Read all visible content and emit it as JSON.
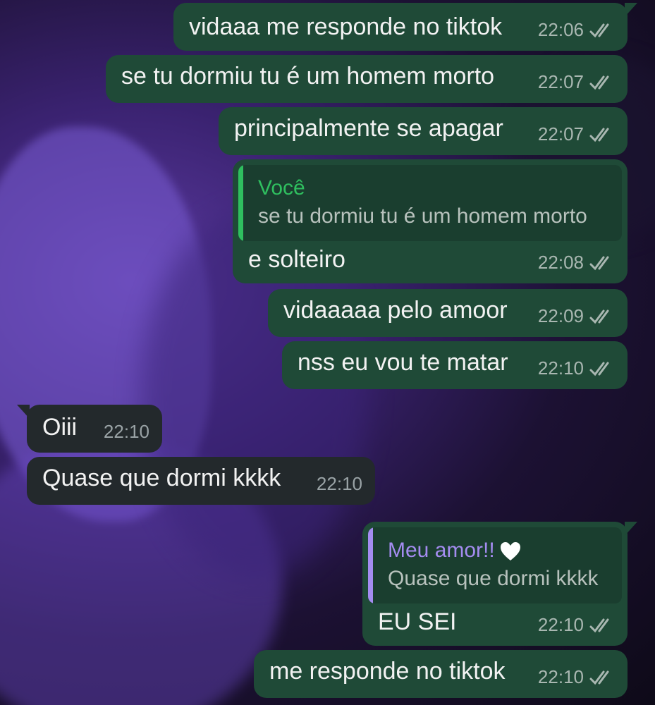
{
  "chat": {
    "messages": [
      {
        "text": "vidaaa me responde no tiktok",
        "time": "22:06"
      },
      {
        "text": "se tu dormiu tu é um homem morto",
        "time": "22:07"
      },
      {
        "text": "principalmente se apagar",
        "time": "22:07"
      },
      {
        "reply_author": "Você",
        "reply_text": "se tu dormiu tu é um homem morto",
        "text": "e solteiro",
        "time": "22:08"
      },
      {
        "text": "vidaaaaa pelo amoor",
        "time": "22:09"
      },
      {
        "text": "nss eu vou te matar",
        "time": "22:10"
      },
      {
        "text": "Oiii",
        "time": "22:10"
      },
      {
        "text": "Quase que dormi kkkk",
        "time": "22:10"
      },
      {
        "reply_author": "Meu amor!!",
        "reply_text": "Quase que dormi kkkk",
        "text": "EU SEI",
        "time": "22:10"
      },
      {
        "text": "me responde no tiktok",
        "time": "22:10"
      }
    ]
  },
  "colors": {
    "outgoing_bubble": "#1f4a37",
    "incoming_bubble": "#23292c",
    "self_quote_accent": "#2fbf5f",
    "contact_quote_accent": "#a48cf0",
    "read_ticks": "#a9b7b1"
  },
  "icons": {
    "read_receipt": "double-check-icon",
    "emoji": "white-heart-icon"
  }
}
